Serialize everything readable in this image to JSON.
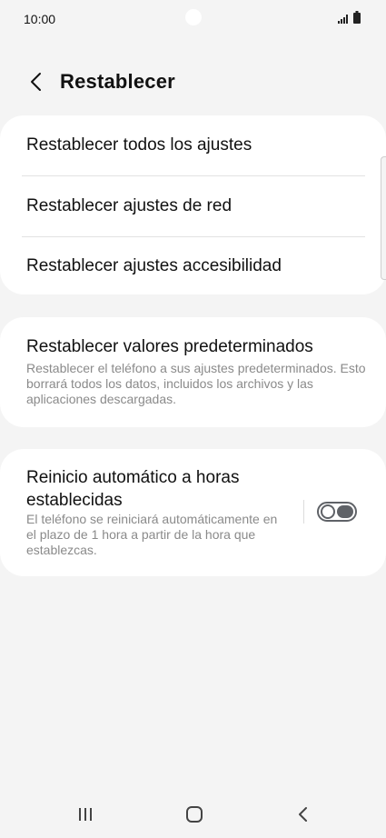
{
  "status_bar": {
    "time": "10:00",
    "icons": [
      "signal-icon",
      "battery-icon"
    ]
  },
  "header": {
    "title": "Restablecer",
    "back_icon": "chevron-left-icon"
  },
  "reset_options": [
    {
      "label": "Restablecer todos los ajustes"
    },
    {
      "label": "Restablecer ajustes de red"
    },
    {
      "label": "Restablecer ajustes accesibilidad"
    }
  ],
  "factory_reset": {
    "title": "Restablecer valores predeterminados",
    "description": "Restablecer el teléfono a sus ajustes predeterminados. Esto borrará todos los datos, incluidos los archivos y las aplicaciones descargadas."
  },
  "auto_restart": {
    "title": "Reinicio automático a horas establecidas",
    "description": "El teléfono se reiniciará automáticamente en el plazo de 1 hora a partir de la hora que establezcas.",
    "enabled": false
  },
  "nav_bar": {
    "icons": [
      "recent-apps-icon",
      "home-icon",
      "back-icon"
    ]
  },
  "colors": {
    "background": "#f4f4f4",
    "card": "#ffffff",
    "text_primary": "#111111",
    "text_secondary": "#8a8a8a",
    "toggle_off": "#5f6267"
  }
}
